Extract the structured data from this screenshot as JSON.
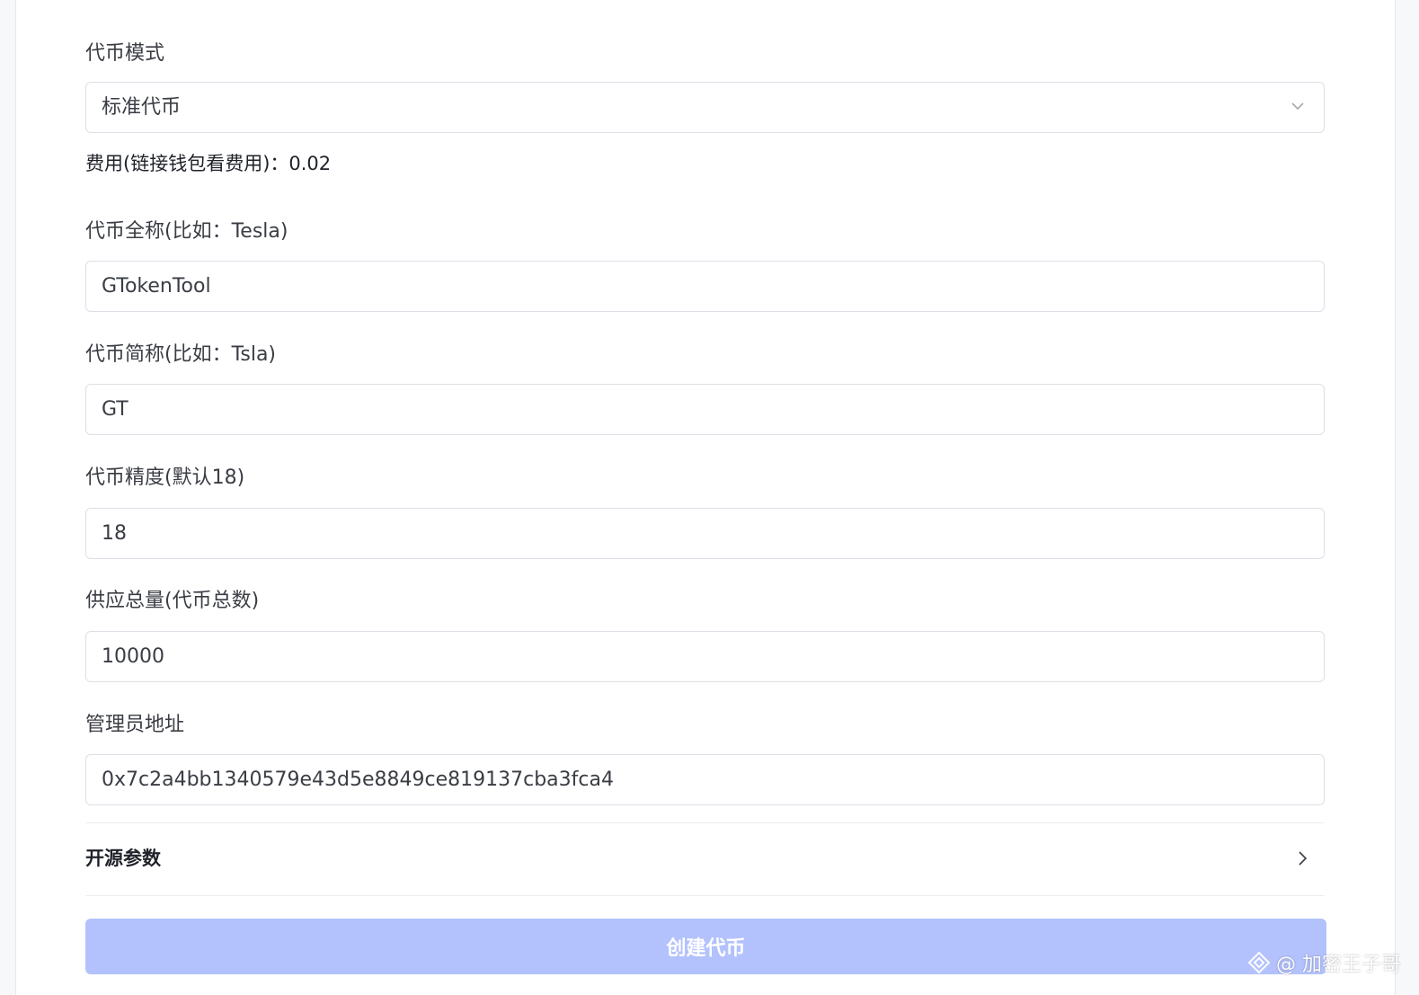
{
  "form": {
    "token_mode": {
      "label": "代币模式",
      "selected": "标准代币"
    },
    "fee_text": "费用(链接钱包看费用)：0.02",
    "full_name": {
      "label": "代币全称(比如：Tesla)",
      "value": "GTokenTool"
    },
    "symbol": {
      "label": "代币简称(比如：Tsla)",
      "value": "GT"
    },
    "decimals": {
      "label": "代币精度(默认18)",
      "value": "18"
    },
    "supply": {
      "label": "供应总量(代币总数)",
      "value": "10000"
    },
    "owner": {
      "label": "管理员地址",
      "value": "0x7c2a4bb1340579e43d5e8849ce819137cba3fca4"
    },
    "open_source": {
      "label": "开源参数"
    },
    "submit_label": "创建代币"
  },
  "watermark": {
    "text": "@ 加密王子哥"
  },
  "colors": {
    "submit_bg": "#b3c2fd",
    "border": "#dcdfe6",
    "label_text": "#3a3d44"
  }
}
